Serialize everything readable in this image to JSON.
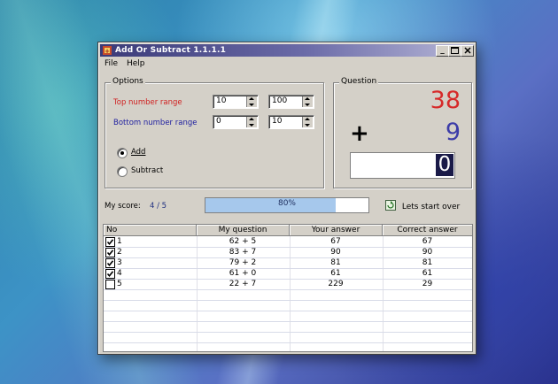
{
  "window": {
    "title": "Add Or Subtract 1.1.1.1"
  },
  "menu": [
    "File",
    "Help"
  ],
  "options": {
    "group_title": "Options",
    "top_range_label": "Top number range",
    "top_min": "10",
    "top_max": "100",
    "bottom_range_label": "Bottom number range",
    "bottom_min": "0",
    "bottom_max": "10",
    "add_label": "Add",
    "subtract_label": "Subtract",
    "selected_operation": "Add"
  },
  "question": {
    "group_title": "Question",
    "top_number": "38",
    "bottom_number": "9",
    "operator": "+",
    "answer_value": "0"
  },
  "score": {
    "label": "My score:",
    "value": "4 / 5",
    "progress_text": "80%",
    "progress_fraction": 0.8,
    "restart_label": "Lets start over"
  },
  "table": {
    "columns": [
      "No",
      "My question",
      "Your answer",
      "Correct answer"
    ],
    "rows": [
      {
        "no": "1",
        "question": "62 + 5",
        "your": "67",
        "correct": "67",
        "checked": true
      },
      {
        "no": "2",
        "question": "83 + 7",
        "your": "90",
        "correct": "90",
        "checked": true
      },
      {
        "no": "3",
        "question": "79 + 2",
        "your": "81",
        "correct": "81",
        "checked": true
      },
      {
        "no": "4",
        "question": "61 + 0",
        "your": "61",
        "correct": "61",
        "checked": true
      },
      {
        "no": "5",
        "question": "22 + 7",
        "your": "229",
        "correct": "29",
        "checked": false
      }
    ]
  },
  "colors": {
    "top_number": "#d62a2a",
    "bottom_number": "#3c3ca8",
    "top_label": "#d02020",
    "bottom_label": "#2020a0"
  }
}
